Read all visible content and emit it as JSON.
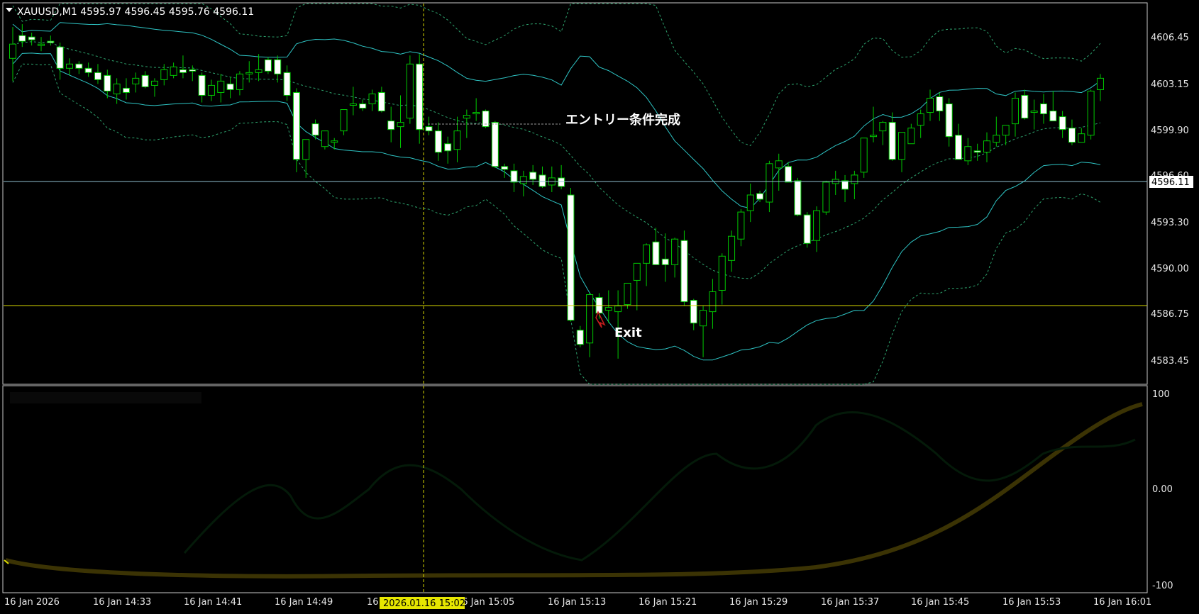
{
  "window": {
    "title": "XAUUSD,M1  4595.97 4596.45 4595.76 4596.11",
    "menu_icon": "triangle-down-icon"
  },
  "colors": {
    "background": "#000000",
    "frame": "#c8c8c8",
    "bull_body": "#000000",
    "bull_outline": "#00c800",
    "bear_body": "#ffffff",
    "wick": "#00c800",
    "band_solid": "#2ec4c4",
    "band_dotted": "#2ea46e",
    "price_line": "#8fbfcf",
    "yellow_line": "#d8d800",
    "cursor": "#d8d800",
    "exit_arrow": "#c81e1e"
  },
  "price_axis": {
    "labels": [
      "4606.45",
      "4603.15",
      "4599.90",
      "4596.60",
      "4593.30",
      "4590.00",
      "4586.75",
      "4583.45"
    ],
    "current_price": "4596.11"
  },
  "indicator_axis": {
    "labels": [
      "100",
      "0.00",
      "-100"
    ]
  },
  "time_axis": {
    "labels": [
      "16 Jan 2026",
      "16 Jan 14:33",
      "16 Jan 14:41",
      "16 Jan 14:49",
      "16",
      "16 Jan 15:05",
      "16 Jan 15:13",
      "16 Jan 15:21",
      "16 Jan 15:29",
      "16 Jan 15:37",
      "16 Jan 15:45",
      "16 Jan 15:53",
      "16 Jan 16:01"
    ],
    "cursor_label": "2026.01.16 15:02"
  },
  "annotations": {
    "entry": "エントリー条件完成",
    "exit": "Exit"
  },
  "chart_data": {
    "type": "candlestick",
    "symbol": "XAUUSD",
    "timeframe": "M1",
    "ylim": [
      4582.0,
      4608.5
    ],
    "horizontal_lines": [
      4596.11,
      4587.65
    ],
    "candles": [
      [
        4605.0,
        4607.2,
        4603.4,
        4606.0
      ],
      [
        4606.6,
        4607.4,
        4605.8,
        4606.2
      ],
      [
        4606.5,
        4606.8,
        4605.9,
        4606.3
      ],
      [
        4606.0,
        4606.5,
        4605.5,
        4606.0
      ],
      [
        4606.2,
        4606.6,
        4605.9,
        4606.1
      ],
      [
        4605.8,
        4606.1,
        4603.5,
        4604.3
      ],
      [
        4604.3,
        4605.0,
        4603.8,
        4604.6
      ],
      [
        4604.6,
        4604.8,
        4603.9,
        4604.3
      ],
      [
        4604.3,
        4604.7,
        4603.7,
        4604.0
      ],
      [
        4604.0,
        4604.6,
        4603.2,
        4603.5
      ],
      [
        4603.8,
        4604.2,
        4602.2,
        4602.7
      ],
      [
        4602.5,
        4603.6,
        4601.8,
        4603.2
      ],
      [
        4602.9,
        4603.6,
        4602.1,
        4602.6
      ],
      [
        4603.2,
        4604.0,
        4602.6,
        4603.6
      ],
      [
        4603.8,
        4604.1,
        4602.9,
        4603.0
      ],
      [
        4603.1,
        4603.6,
        4602.3,
        4603.4
      ],
      [
        4603.5,
        4604.6,
        4603.1,
        4604.2
      ],
      [
        4603.8,
        4604.7,
        4603.6,
        4604.4
      ],
      [
        4604.2,
        4605.2,
        4603.6,
        4604.0
      ],
      [
        4604.2,
        4604.5,
        4603.4,
        4604.1
      ],
      [
        4603.8,
        4604.0,
        4601.9,
        4602.4
      ],
      [
        4602.4,
        4603.5,
        4602.0,
        4603.1
      ],
      [
        4602.6,
        4603.9,
        4601.9,
        4603.4
      ],
      [
        4603.2,
        4603.7,
        4602.2,
        4602.8
      ],
      [
        4602.8,
        4604.1,
        4602.4,
        4603.9
      ],
      [
        4603.9,
        4604.8,
        4603.3,
        4604.0
      ],
      [
        4604.0,
        4605.3,
        4603.4,
        4604.2
      ],
      [
        4604.9,
        4605.1,
        4603.9,
        4604.1
      ],
      [
        4604.9,
        4605.2,
        4603.3,
        4603.9
      ],
      [
        4604.0,
        4604.5,
        4602.0,
        4602.4
      ],
      [
        4602.6,
        4602.9,
        4597.0,
        4597.9
      ],
      [
        4597.9,
        4599.3,
        4596.6,
        4599.3
      ],
      [
        4600.4,
        4600.7,
        4599.3,
        4599.6
      ],
      [
        4598.8,
        4599.9,
        4598.6,
        4599.9
      ],
      [
        4599.2,
        4599.4,
        4598.6,
        4599.2
      ],
      [
        4599.9,
        4601.4,
        4599.6,
        4601.4
      ],
      [
        4601.7,
        4603.0,
        4601.0,
        4601.8
      ],
      [
        4601.8,
        4602.1,
        4601.3,
        4601.5
      ],
      [
        4601.8,
        4602.8,
        4601.3,
        4602.5
      ],
      [
        4602.6,
        4603.0,
        4601.2,
        4601.3
      ],
      [
        4600.6,
        4601.6,
        4599.1,
        4600.0
      ],
      [
        4600.2,
        4602.4,
        4598.7,
        4600.5
      ],
      [
        4600.8,
        4605.2,
        4600.4,
        4604.6
      ],
      [
        4604.6,
        4605.3,
        4599.0,
        4600.0
      ],
      [
        4600.2,
        4600.9,
        4599.6,
        4599.9
      ],
      [
        4599.9,
        4600.5,
        4597.8,
        4598.4
      ],
      [
        4599.0,
        4599.5,
        4597.6,
        4598.5
      ],
      [
        4598.6,
        4600.9,
        4597.7,
        4599.9
      ],
      [
        4600.8,
        4601.4,
        4599.4,
        4601.0
      ],
      [
        4601.1,
        4602.2,
        4600.6,
        4601.2
      ],
      [
        4601.3,
        4601.4,
        4600.1,
        4600.2
      ],
      [
        4600.5,
        4600.6,
        4597.3,
        4597.4
      ],
      [
        4597.4,
        4597.6,
        4596.6,
        4597.2
      ],
      [
        4597.1,
        4597.6,
        4595.6,
        4596.3
      ],
      [
        4596.2,
        4597.1,
        4595.3,
        4596.7
      ],
      [
        4597.0,
        4597.5,
        4596.1,
        4596.5
      ],
      [
        4596.8,
        4597.4,
        4595.9,
        4596.0
      ],
      [
        4596.1,
        4597.4,
        4595.6,
        4596.6
      ],
      [
        4596.6,
        4597.5,
        4595.8,
        4596.0
      ],
      [
        4595.4,
        4595.9,
        4586.5,
        4586.6
      ],
      [
        4585.9,
        4586.2,
        4584.7,
        4584.9
      ],
      [
        4585.0,
        4588.5,
        4584.0,
        4588.4
      ],
      [
        4588.2,
        4588.5,
        4586.7,
        4587.1
      ],
      [
        4587.3,
        4588.7,
        4586.4,
        4587.5
      ],
      [
        4587.2,
        4588.7,
        4583.9,
        4587.6
      ],
      [
        4587.7,
        4589.2,
        4587.4,
        4589.2
      ],
      [
        4589.4,
        4590.6,
        4587.3,
        4590.6
      ],
      [
        4590.6,
        4592.0,
        4589.0,
        4591.9
      ],
      [
        4592.1,
        4593.1,
        4590.9,
        4590.5
      ],
      [
        4590.9,
        4592.7,
        4589.3,
        4590.5
      ],
      [
        4590.5,
        4592.4,
        4589.6,
        4592.3
      ],
      [
        4592.2,
        4592.9,
        4587.6,
        4587.9
      ],
      [
        4588.0,
        4588.1,
        4585.9,
        4586.4
      ],
      [
        4586.2,
        4587.6,
        4584.0,
        4587.3
      ],
      [
        4587.2,
        4589.5,
        4586.0,
        4588.6
      ],
      [
        4588.7,
        4591.3,
        4587.7,
        4591.1
      ],
      [
        4590.8,
        4592.9,
        4590.0,
        4592.5
      ],
      [
        4592.3,
        4594.4,
        4591.8,
        4594.2
      ],
      [
        4594.3,
        4596.2,
        4593.5,
        4595.4
      ],
      [
        4595.5,
        4595.7,
        4594.9,
        4595.1
      ],
      [
        4594.9,
        4597.8,
        4594.2,
        4597.6
      ],
      [
        4597.3,
        4598.3,
        4595.7,
        4597.8
      ],
      [
        4597.4,
        4597.7,
        4596.5,
        4596.3
      ],
      [
        4596.4,
        4596.6,
        4593.9,
        4594.0
      ],
      [
        4594.0,
        4594.2,
        4591.7,
        4592.0
      ],
      [
        4592.2,
        4594.6,
        4591.4,
        4594.3
      ],
      [
        4594.2,
        4596.4,
        4594.0,
        4596.3
      ],
      [
        4596.2,
        4597.1,
        4595.4,
        4596.5
      ],
      [
        4596.4,
        4596.8,
        4594.9,
        4595.8
      ],
      [
        4596.2,
        4597.1,
        4595.1,
        4596.8
      ],
      [
        4597.0,
        4599.4,
        4596.6,
        4599.4
      ],
      [
        4599.6,
        4601.6,
        4599.1,
        4599.6
      ],
      [
        4599.9,
        4600.6,
        4598.9,
        4600.5
      ],
      [
        4600.5,
        4601.2,
        4597.8,
        4597.9
      ],
      [
        4597.9,
        4599.5,
        4597.0,
        4599.8
      ],
      [
        4599.0,
        4600.4,
        4599.0,
        4600.1
      ],
      [
        4600.3,
        4601.4,
        4599.4,
        4601.1
      ],
      [
        4601.2,
        4602.8,
        4600.6,
        4602.2
      ],
      [
        4602.3,
        4602.6,
        4600.6,
        4601.3
      ],
      [
        4601.8,
        4602.2,
        4598.8,
        4599.5
      ],
      [
        4599.6,
        4600.4,
        4597.9,
        4597.9
      ],
      [
        4597.8,
        4599.4,
        4597.5,
        4598.8
      ],
      [
        4598.5,
        4599.0,
        4597.8,
        4598.4
      ],
      [
        4598.4,
        4599.8,
        4597.7,
        4599.2
      ],
      [
        4599.1,
        4600.9,
        4598.8,
        4599.6
      ],
      [
        4599.6,
        4600.3,
        4598.9,
        4600.3
      ],
      [
        4600.4,
        4602.6,
        4599.5,
        4602.2
      ],
      [
        4602.4,
        4602.8,
        4600.7,
        4600.8
      ],
      [
        4601.3,
        4602.1,
        4600.0,
        4601.3
      ],
      [
        4601.8,
        4602.5,
        4600.4,
        4601.1
      ],
      [
        4601.3,
        4602.7,
        4600.8,
        4600.6
      ],
      [
        4600.9,
        4601.3,
        4599.4,
        4600.0
      ],
      [
        4600.1,
        4600.7,
        4598.9,
        4599.1
      ],
      [
        4599.1,
        4600.1,
        4599.1,
        4599.7
      ],
      [
        4599.6,
        4602.8,
        4599.3,
        4602.7
      ],
      [
        4602.8,
        4603.9,
        4602.0,
        4603.6
      ]
    ],
    "indicator_ylim": [
      -100,
      100
    ]
  }
}
